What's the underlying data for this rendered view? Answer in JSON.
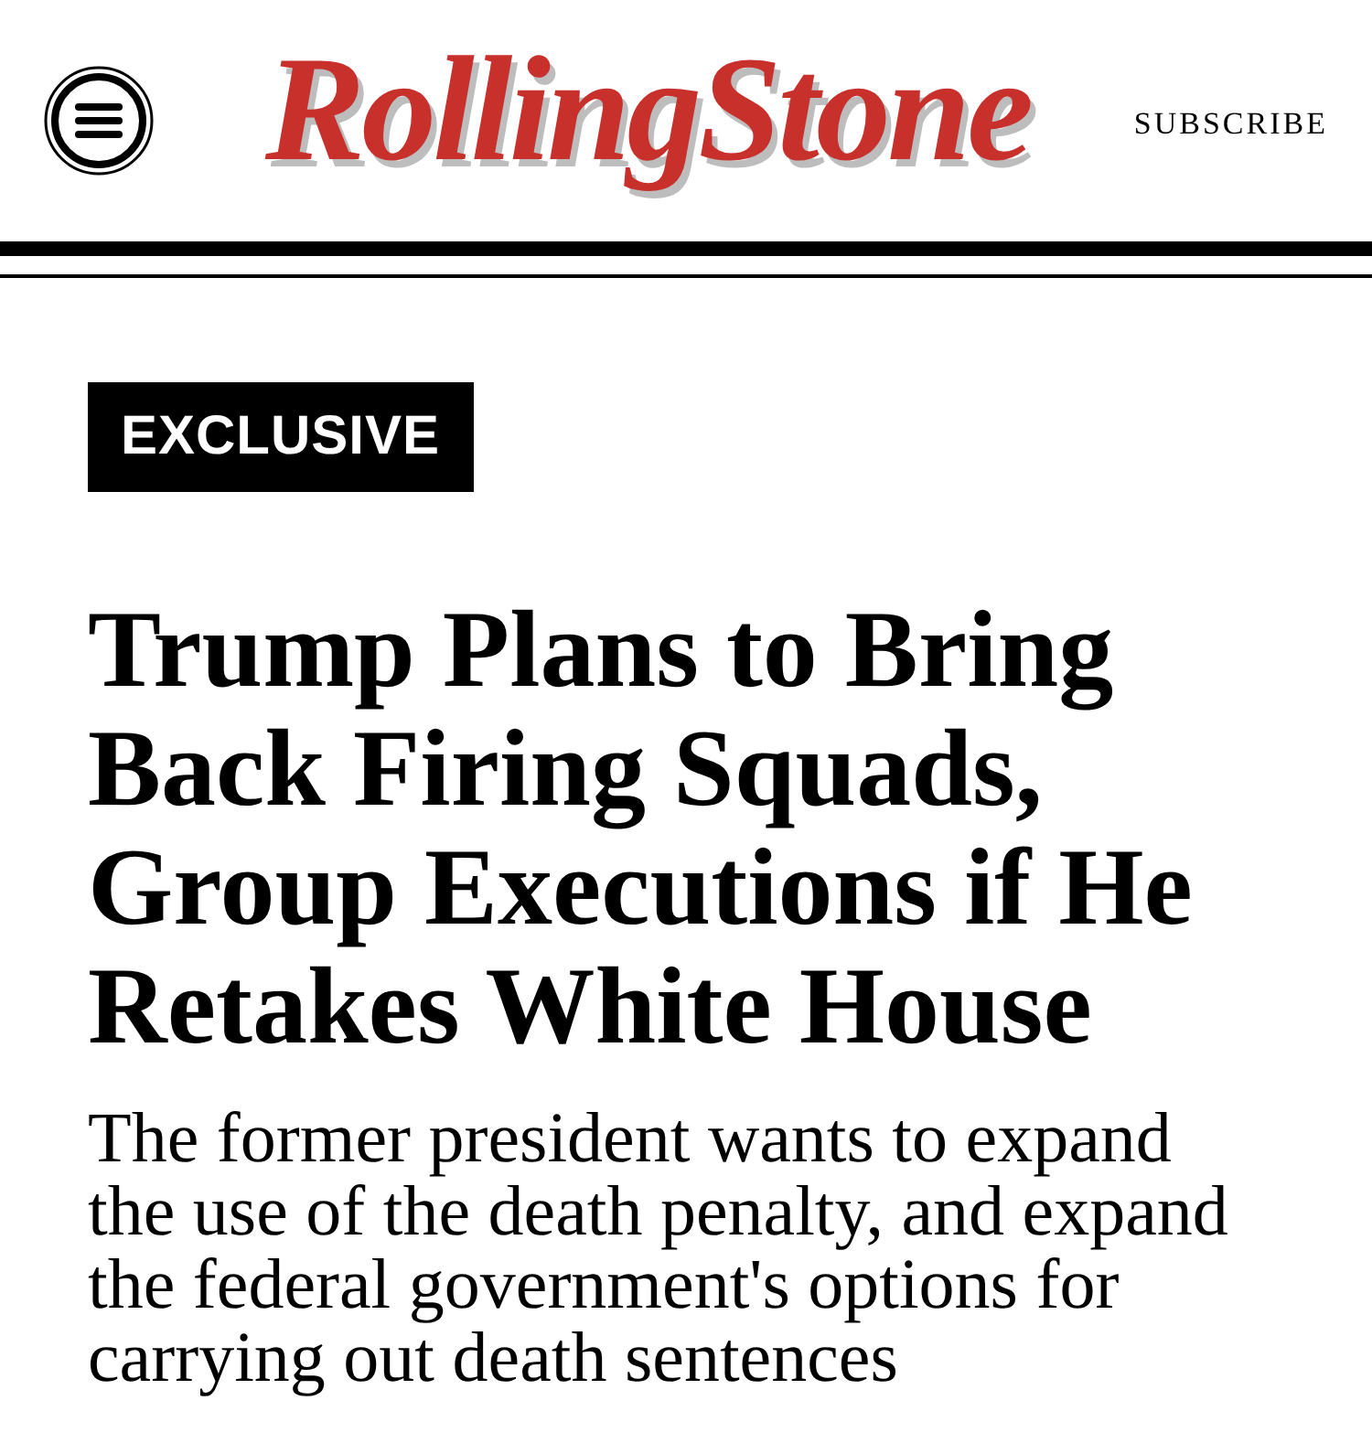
{
  "header": {
    "logo": "RollingStone",
    "subscribe": "SUBSCRIBE"
  },
  "article": {
    "badge": "EXCLUSIVE",
    "headline": "Trump Plans to Bring Back Firing Squads, Group Executions if He Retakes White House",
    "dek": "The former president wants to expand the use of the death penalty, and expand the federal government's options for carrying out death sentences"
  }
}
